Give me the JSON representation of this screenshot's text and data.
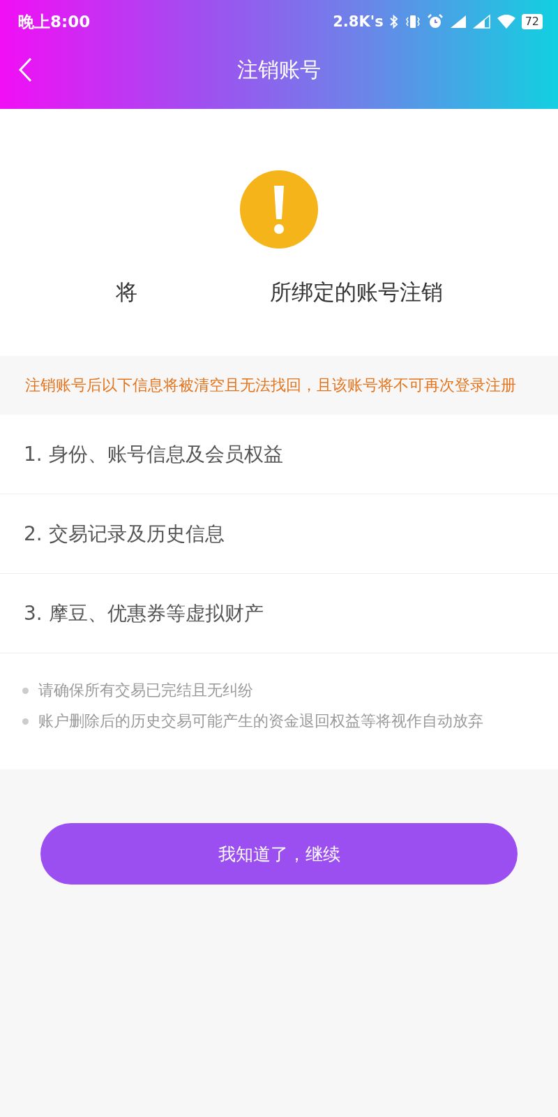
{
  "status_bar": {
    "time": "晚上8:00",
    "net_speed": "2.8K's",
    "battery": "72"
  },
  "header": {
    "title": "注销账号"
  },
  "confirm": {
    "prefix": "将",
    "suffix": "所绑定的账号注销"
  },
  "warning": "注销账号后以下信息将被清空且无法找回，且该账号将不可再次登录注册",
  "items": [
    "1. 身份、账号信息及会员权益",
    "2. 交易记录及历史信息",
    "3. 摩豆、优惠券等虚拟财产"
  ],
  "notes": [
    "请确保所有交易已完结且无纠纷",
    "账户删除后的历史交易可能产生的资金退回权益等将视作自动放弃"
  ],
  "button": "我知道了，继续"
}
